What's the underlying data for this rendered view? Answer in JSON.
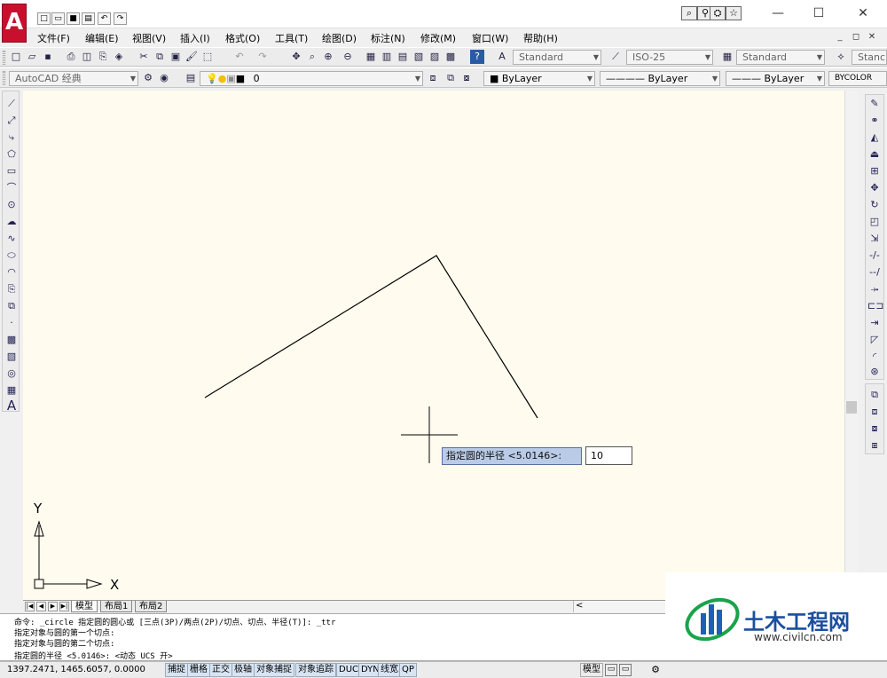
{
  "app": {
    "logo_letter": "A",
    "window_controls": {
      "minimize": "—",
      "maximize": "☐",
      "close": "✕"
    },
    "search_icons": [
      "search-icon",
      "star-icon"
    ]
  },
  "menu": {
    "items": [
      "文件(F)",
      "编辑(E)",
      "视图(V)",
      "插入(I)",
      "格式(O)",
      "工具(T)",
      "绘图(D)",
      "标注(N)",
      "修改(M)",
      "窗口(W)",
      "帮助(H)"
    ],
    "mdi_controls": [
      "_",
      "◻",
      "✕"
    ]
  },
  "toolbar1": {
    "text_style": "Standard",
    "dim_style": "ISO-25",
    "table_style": "Standard",
    "multileader_style": "Stanc"
  },
  "toolbar2": {
    "workspace": "AutoCAD 经典",
    "layer": "0",
    "color": "ByLayer",
    "linetype": "ByLayer",
    "lineweight": "ByLayer",
    "plotstyle": "BYCOLOR"
  },
  "canvas": {
    "ucs_x": "X",
    "ucs_y": "Y"
  },
  "dynamic_input": {
    "prompt": "指定圆的半径 <5.0146>:",
    "value": "10"
  },
  "tabs": {
    "nav": [
      "|◀",
      "◀",
      "▶",
      "▶|"
    ],
    "items": [
      "模型",
      "布局1",
      "布局2"
    ],
    "hscroll_arrow": "<"
  },
  "command": {
    "lines": [
      "命令: _circle 指定圆的圆心或 [三点(3P)/两点(2P)/切点、切点、半径(T)]: _ttr",
      "指定对象与圆的第一个切点:",
      "指定对象与圆的第二个切点:"
    ],
    "prompt": "指定圆的半径 <5.0146>:  <动态 UCS 开>"
  },
  "status": {
    "coords": "1397.2471, 1465.6057, 0.0000",
    "buttons": [
      "捕捉",
      "栅格",
      "正交",
      "极轴",
      "对象捕捉",
      "对象追踪",
      "DUCS",
      "DYN",
      "线宽",
      "QP"
    ],
    "model_label": "模型"
  },
  "watermark": {
    "title": "土木工程网",
    "url": "www.civilcn.com"
  },
  "colors": {
    "canvas_bg": "#fffbef",
    "accent_red": "#c8102e",
    "dyn_prompt_bg": "#b9cbe6"
  }
}
